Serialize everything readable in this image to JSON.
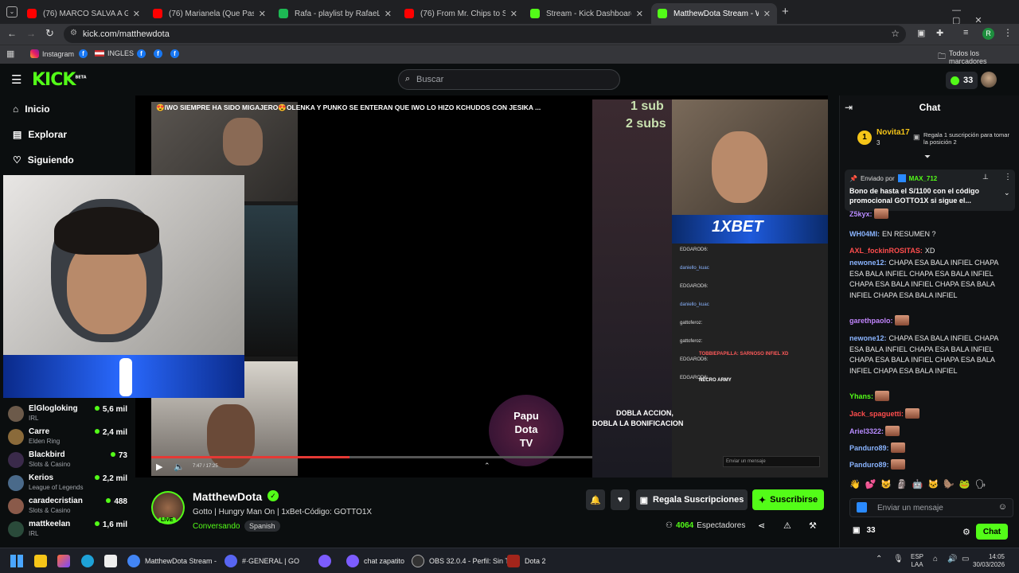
{
  "browser": {
    "tabs": [
      {
        "title": "(76) MARCO SALVA A GRACE D",
        "color": "#ff0000"
      },
      {
        "title": "(76) Marianela (Que Pasa) (Exte",
        "color": "#ff0000"
      },
      {
        "title": "Rafa - playlist by RafaeLxared |",
        "color": "#1db954"
      },
      {
        "title": "(76) From Mr. Chips to Scarface",
        "color": "#ff0000"
      },
      {
        "title": "Stream - Kick Dashboard",
        "color": "#53fc18"
      },
      {
        "title": "MatthewDota Stream - Wa",
        "color": "#53fc18"
      }
    ],
    "new_tab": "+",
    "url": "kick.com/matthewdota",
    "bookmarks": [
      {
        "label": "Instagram"
      },
      {
        "label": "f"
      },
      {
        "label": "INGLES"
      },
      {
        "label": "f"
      },
      {
        "label": "f"
      },
      {
        "label": "f"
      }
    ],
    "all_bookmarks": "Todos los marcadores",
    "profile_initial": "R"
  },
  "kick": {
    "logo": "KICK",
    "logo_badge": "BETA",
    "search_placeholder": "Buscar",
    "kicks_count": "33"
  },
  "sidebar": {
    "nav": [
      {
        "label": "Inicio"
      },
      {
        "label": "Explorar"
      },
      {
        "label": "Siguiendo"
      }
    ],
    "channels": [
      {
        "name": "ElGlogloking",
        "category": "IRL",
        "viewers": "5,6 mil",
        "color": "#6c5a4a"
      },
      {
        "name": "Carre",
        "category": "Elden Ring",
        "viewers": "2,4 mil",
        "color": "#8a6a3a"
      },
      {
        "name": "Blackbird",
        "category": "Slots & Casino",
        "viewers": "73",
        "color": "#3a2a4a"
      },
      {
        "name": "Kerios",
        "category": "League of Legends",
        "viewers": "2,2 mil",
        "color": "#4a6a8a"
      },
      {
        "name": "caradecristian",
        "category": "Slots & Casino",
        "viewers": "488",
        "color": "#8a5a4a"
      },
      {
        "name": "mattkeelan",
        "category": "IRL",
        "viewers": "1,6 mil",
        "color": "#2a4a3a"
      }
    ]
  },
  "video": {
    "banner": "😍IWO SIEMPRE HA SIDO MIGAJERO😍OLENKA Y PUNKO SE ENTERAN QUE IWO LO HIZO KCHUDOS CON JESIKA ...",
    "time": "7:47 / 17:25",
    "progress": 0.45,
    "sub_text_1": "1 sub",
    "sub_text_2": "2 subs",
    "sponsor": "1XBET",
    "watermark": [
      "Papu",
      "Dota",
      "TV"
    ],
    "promo": [
      "DOBLA ACCION,",
      "DOBLA LA BONIFICACION"
    ],
    "overlay_chat": [
      {
        "user": "EDGAROD6:",
        "color": "#fff"
      },
      {
        "user": "daniello_kuac",
        "color": "#8ab4ff"
      },
      {
        "user": "EDGAROD6:",
        "color": "#fff"
      },
      {
        "user": "daniello_kuac",
        "color": "#8ab4ff"
      },
      {
        "user": "gattoferoz:",
        "color": "#fff"
      },
      {
        "user": "gattoferoz:",
        "color": "#fff"
      },
      {
        "user": "EDGAROD6:",
        "color": "#fff"
      },
      {
        "user": "EDGAROD6:",
        "color": "#fff"
      }
    ],
    "overlay_red": "TOBBIEPAPILLA: SARNOSO INFIEL XD",
    "overlay_army": "NECRO ARMY",
    "overlay_input": "Enviar un mensaje"
  },
  "channel": {
    "name": "MatthewDota",
    "live_badge": "LIVE",
    "title": "Gotto | Hungry Man On | 1xBet-Código: GOTTO1X",
    "category": "Conversando",
    "language": "Spanish",
    "gift_label": "Regala Suscripciones",
    "subscribe_label": "Suscribirse",
    "viewers_count": "4064",
    "viewers_label": "Espectadores"
  },
  "chat": {
    "title": "Chat",
    "top_gifter": {
      "name": "Novita17",
      "rank": "1",
      "count": "3"
    },
    "gift_prompt": "Regala 1 suscripción para tomar la posición 2",
    "pinned_by_label": "Enviado por",
    "pinned_by_user": "MAX_712",
    "pinned_text": "Bono de hasta el S/1100 con el código promocional GOTTO1X si sigue el...",
    "messages": [
      {
        "user": "Z5kyx:",
        "text": "",
        "color": "#b88cff",
        "emotes": 1
      },
      {
        "user": "WH04MI:",
        "text": "EN RESUMEN ?",
        "color": "#8ab4ff",
        "emotes": 0
      },
      {
        "user": "AXL_fockinROSITAS:",
        "text": "XD",
        "color": "#ff4d4d",
        "emotes": 0
      },
      {
        "user": "newone12:",
        "text": "CHAPA ESA BALA INFIEL CHAPA ESA BALA INFIEL CHAPA ESA BALA INFIEL CHAPA ESA BALA INFIEL CHAPA ESA BALA INFIEL CHAPA ESA BALA INFIEL",
        "color": "#8ab4ff",
        "emotes": 0
      },
      {
        "user": "garethpaolo:",
        "text": "",
        "color": "#c084fc",
        "emotes": 1
      },
      {
        "user": "newone12:",
        "text": "CHAPA ESA BALA INFIEL CHAPA ESA BALA INFIEL CHAPA ESA BALA INFIEL CHAPA ESA BALA INFIEL CHAPA ESA BALA INFIEL CHAPA ESA BALA INFIEL",
        "color": "#8ab4ff",
        "emotes": 0
      },
      {
        "user": "Yhans:",
        "text": "",
        "color": "#53fc18",
        "emotes": 1
      },
      {
        "user": "Jack_spaguetti:",
        "text": "",
        "color": "#ff4d4d",
        "emotes": 1
      },
      {
        "user": "Ariel3322:",
        "text": "",
        "color": "#b88cff",
        "emotes": 1
      },
      {
        "user": "Panduro89:",
        "text": "",
        "color": "#8ab4ff",
        "emotes": 1
      },
      {
        "user": "Panduro89:",
        "text": "",
        "color": "#8ab4ff",
        "emotes": 1
      }
    ],
    "input_placeholder": "Enviar un mensaje",
    "kicks_count": "33",
    "send_label": "Chat"
  },
  "taskbar": {
    "items": [
      {
        "label": "MatthewDota Stream - ",
        "color": "#4285f4"
      },
      {
        "label": "#·GENERAL | GO",
        "color": "#5865f2"
      },
      {
        "label": "chat zapatito",
        "color": "#7c5cff"
      },
      {
        "label": "OBS 32.0.4 - Perfil: Sin T",
        "color": "#333"
      },
      {
        "label": "Dota 2",
        "color": "#a3251b"
      }
    ],
    "lang_1": "ESP",
    "lang_2": "LAA",
    "time": "14:05",
    "date": "30/03/2026"
  }
}
